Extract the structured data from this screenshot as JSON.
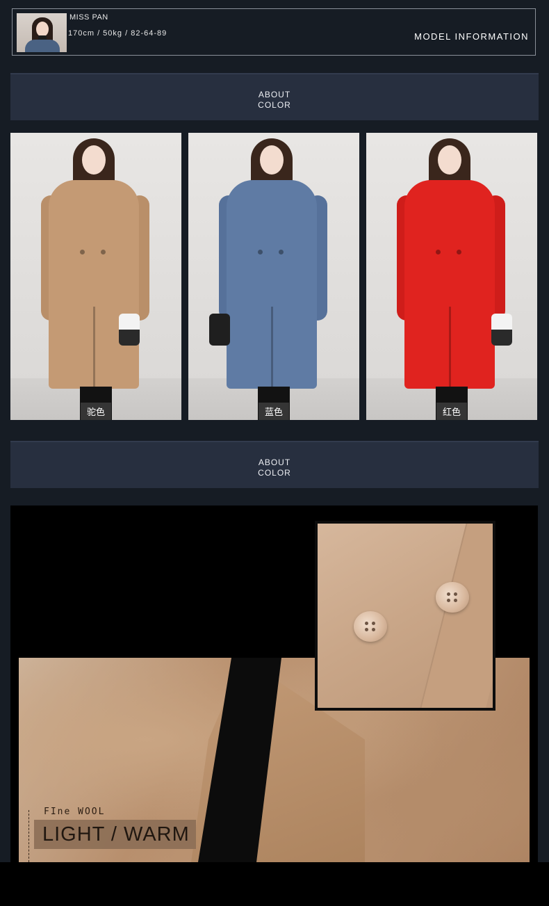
{
  "model": {
    "name": "MISS PAN",
    "stats": "170cm / 50kg / 82-64-89",
    "section_title": "MODEL INFORMATION"
  },
  "color_header_1": {
    "line1": "ABOUT",
    "line2": "COLOR"
  },
  "color_cards": [
    {
      "label": "驼色",
      "coat_color": "#c49a74",
      "bag": "white-black"
    },
    {
      "label": "蓝色",
      "coat_color": "#5f7ba4",
      "bag": "black"
    },
    {
      "label": "红色",
      "coat_color": "#e0231f",
      "bag": "white-black"
    }
  ],
  "color_header_2": {
    "line1": "ABOUT",
    "line2": "COLOR"
  },
  "detail": {
    "small_text": "FIne WOOL",
    "big_text": "LIGHT / WARM",
    "fabric_color": "#c09a79"
  }
}
